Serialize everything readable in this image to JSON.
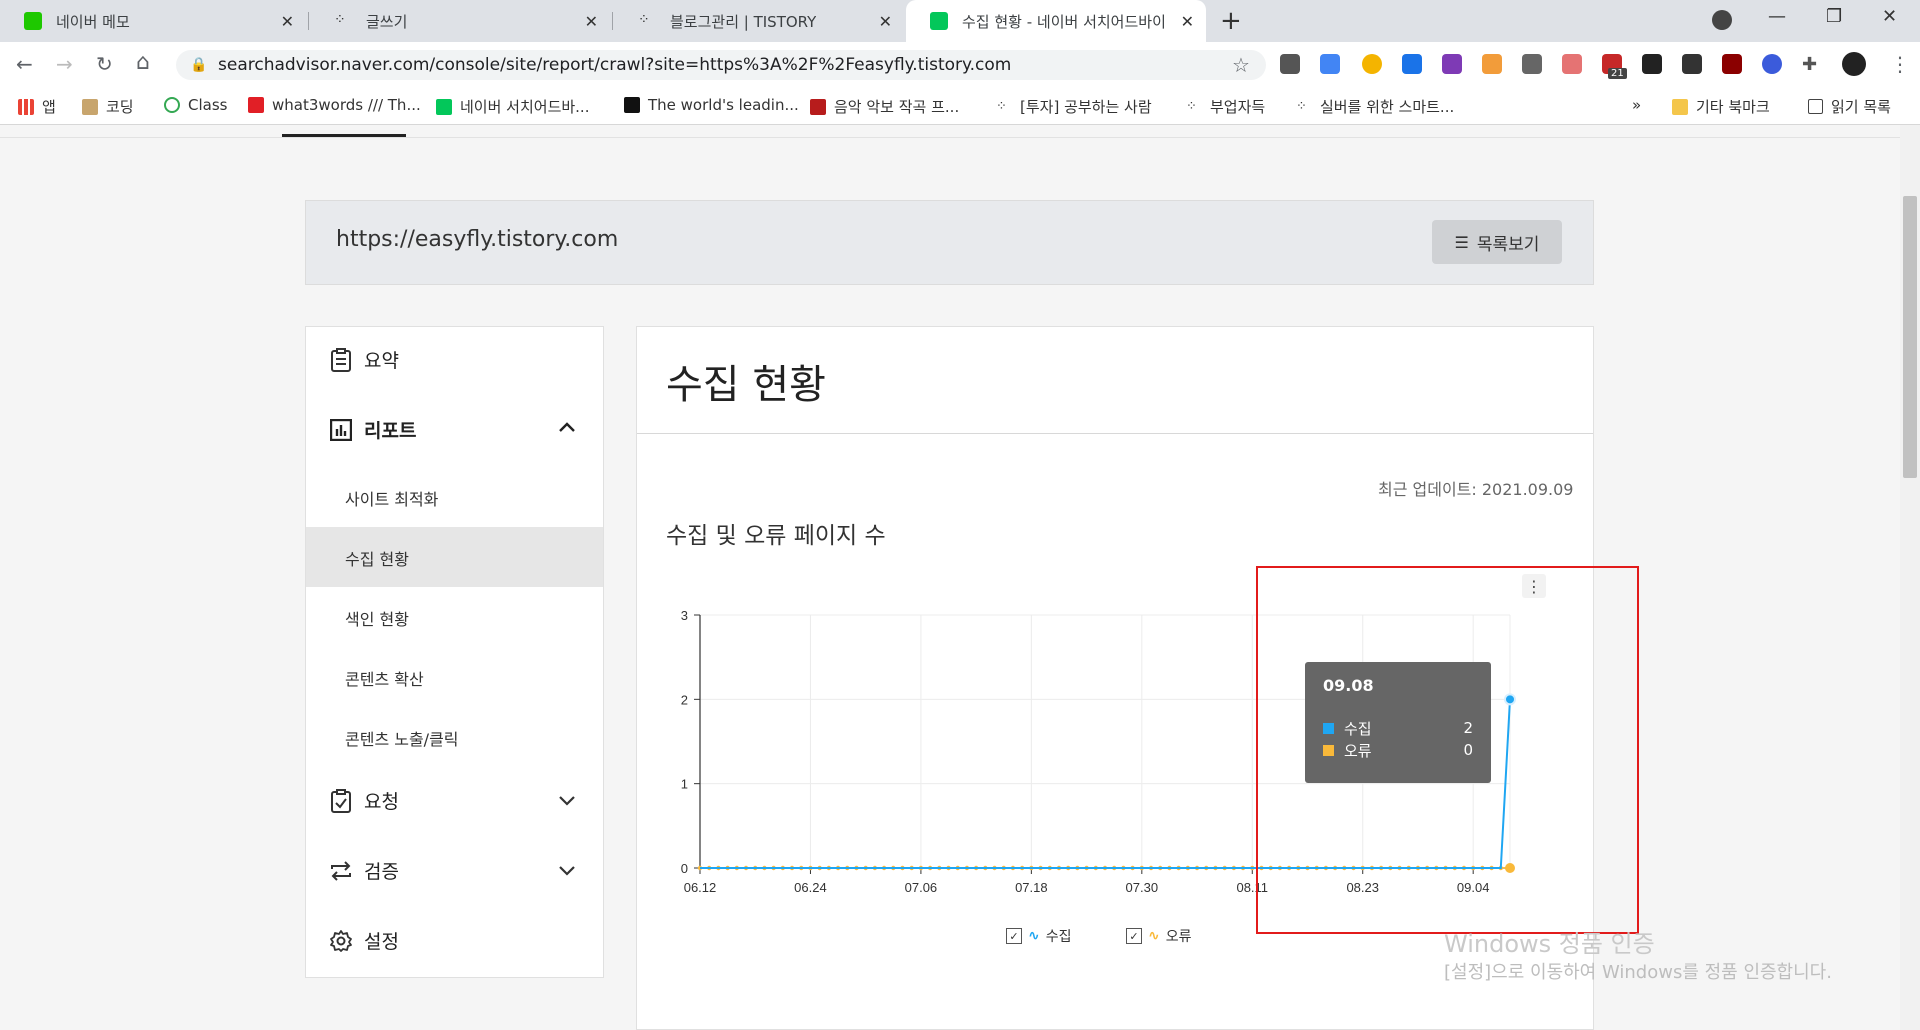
{
  "browser": {
    "tabs": [
      {
        "title": "네이버 메모",
        "favicon_color": "#1ec800"
      },
      {
        "title": "글쓰기",
        "favicon_color": "#333333"
      },
      {
        "title": "블로그관리 | TISTORY",
        "favicon_color": "#333333"
      },
      {
        "title": "수집 현황 - 네이버 서치어드바이",
        "favicon_color": "#03c75a"
      }
    ],
    "url": "searchadvisor.naver.com/console/site/report/crawl?site=https%3A%2F%2Feasyfly.tistory.com",
    "bookmarks": [
      "앱",
      "코딩",
      "Class",
      "what3words /// Th...",
      "네이버 서치어드바...",
      "The world's leadin...",
      "음악 악보 작곡 프...",
      "[투자] 공부하는 사람",
      "부업자득",
      "실버를 위한 스마트...",
      "»",
      "기타 북마크",
      "읽기 목록"
    ],
    "extension_badge": "21"
  },
  "header": {
    "site_url": "https://easyfly.tistory.com",
    "list_button": "목록보기"
  },
  "sidebar": {
    "summary": "요약",
    "report": "리포트",
    "report_items": [
      "사이트 최적화",
      "수집 현황",
      "색인 현황",
      "콘텐츠 확산",
      "콘텐츠 노출/클릭"
    ],
    "active_item": "수집 현황",
    "request": "요청",
    "verify": "검증",
    "settings": "설정"
  },
  "main": {
    "title": "수집 현황",
    "last_updated": "최근 업데이트: 2021.09.09",
    "chart_title": "수집 및 오류 페이지 수"
  },
  "chart_data": {
    "type": "line",
    "title": "수집 및 오류 페이지 수",
    "x_ticks": [
      "06.12",
      "06.24",
      "07.06",
      "07.18",
      "07.30",
      "08.11",
      "08.23",
      "09.04"
    ],
    "x_range": [
      "06.12",
      "09.08"
    ],
    "ylim": [
      0,
      3
    ],
    "y_ticks": [
      0,
      1,
      2,
      3
    ],
    "grid": true,
    "legend_position": "bottom",
    "series": [
      {
        "name": "수집",
        "color": "#1fa6f2",
        "points": [
          {
            "x": "06.12",
            "y": 0
          },
          {
            "x": "09.07",
            "y": 0
          },
          {
            "x": "09.08",
            "y": 2
          }
        ]
      },
      {
        "name": "오류",
        "color": "#f9b93a",
        "points": [
          {
            "x": "06.12",
            "y": 0
          },
          {
            "x": "09.08",
            "y": 0
          }
        ]
      }
    ],
    "tooltip": {
      "date": "09.08",
      "rows": [
        {
          "name": "수집",
          "value": "2",
          "color": "#1fa6f2"
        },
        {
          "name": "오류",
          "value": "0",
          "color": "#f9b93a"
        }
      ]
    }
  },
  "watermark": {
    "line1": "Windows 정품 인증",
    "line2": "[설정]으로 이동하여 Windows를 정품 인증합니다."
  }
}
